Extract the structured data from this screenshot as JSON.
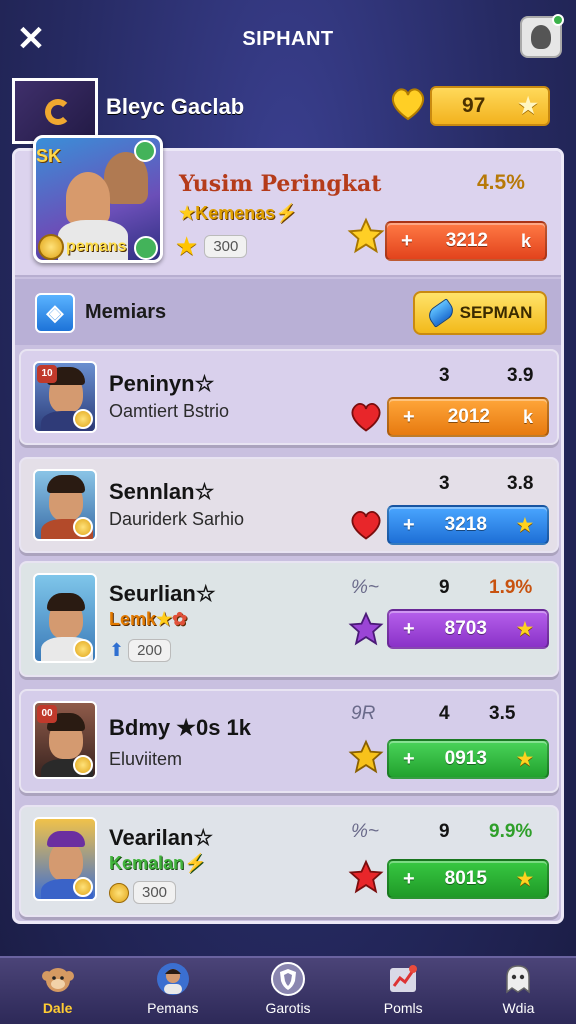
{
  "header": {
    "title": "SIPHANT",
    "close_icon": "close-icon",
    "profile_icon": "profile-icon"
  },
  "player": {
    "name": "Bleyc Gaclab",
    "score": "97",
    "heart_icon": "heart-icon",
    "star_icon": "star-icon"
  },
  "featured": {
    "image_tag": "SK",
    "image_label": "pemans",
    "title": "Yusim Peringkat",
    "percent": "4.5%",
    "subtitle": "Kemenas",
    "star_value": "300",
    "pill_value": "3212",
    "pill_color": "#f0542a"
  },
  "section": {
    "label": "Memiars",
    "button_label": "SEPMAN"
  },
  "rows": [
    {
      "name": "Peninyn",
      "subtitle": "Oamtiert Bstrio",
      "col1": "3",
      "col2": "3.9",
      "pill_value": "2012",
      "pill_end": "k",
      "gem_color": "#e8262a",
      "pill_color": "#f08a1c",
      "rank_label": "10"
    },
    {
      "name": "Sennlan",
      "subtitle": "Dauriderk Sarhio",
      "col1": "3",
      "col2": "3.8",
      "pill_value": "3218",
      "pill_end": "★",
      "gem_color": "#e8262a",
      "pill_color": "#2e8be6"
    },
    {
      "name": "Seurlian",
      "subtitle": "Lemk",
      "mini_value": "200",
      "col1_faint": "%~",
      "col2": "9",
      "col3": "1.9%",
      "pill_value": "8703",
      "pill_end": "★",
      "gem_color": "#9b45d6",
      "pill_color": "#9b45d6"
    },
    {
      "name": "Bdmy ★0s 1k",
      "subtitle": "Eluviitem",
      "col1_faint": "9R",
      "col2": "4",
      "col3": "3.5",
      "pill_value": "0913",
      "pill_end": "★",
      "gem_color": "#f7c21b",
      "pill_color": "#29b33a",
      "rank_label": "00"
    },
    {
      "name": "Vearilan",
      "subtitle": "Kemalan",
      "mini_value": "300",
      "col1_faint": "%~",
      "col2": "9",
      "col3": "9.9%",
      "pill_value": "8015",
      "pill_end": "★",
      "gem_color": "#e8262a",
      "pill_color": "#2aad2e"
    }
  ],
  "nav": [
    {
      "label": "Dale",
      "icon": "monkey-icon",
      "active": true
    },
    {
      "label": "Pemans",
      "icon": "player-icon"
    },
    {
      "label": "Garotis",
      "icon": "shield-icon"
    },
    {
      "label": "Pomls",
      "icon": "chart-icon"
    },
    {
      "label": "Wdia",
      "icon": "ghost-icon"
    }
  ],
  "colors": {
    "background": "#262a62",
    "panel": "#c9c0e0",
    "accent_gold": "#f2b21e"
  }
}
